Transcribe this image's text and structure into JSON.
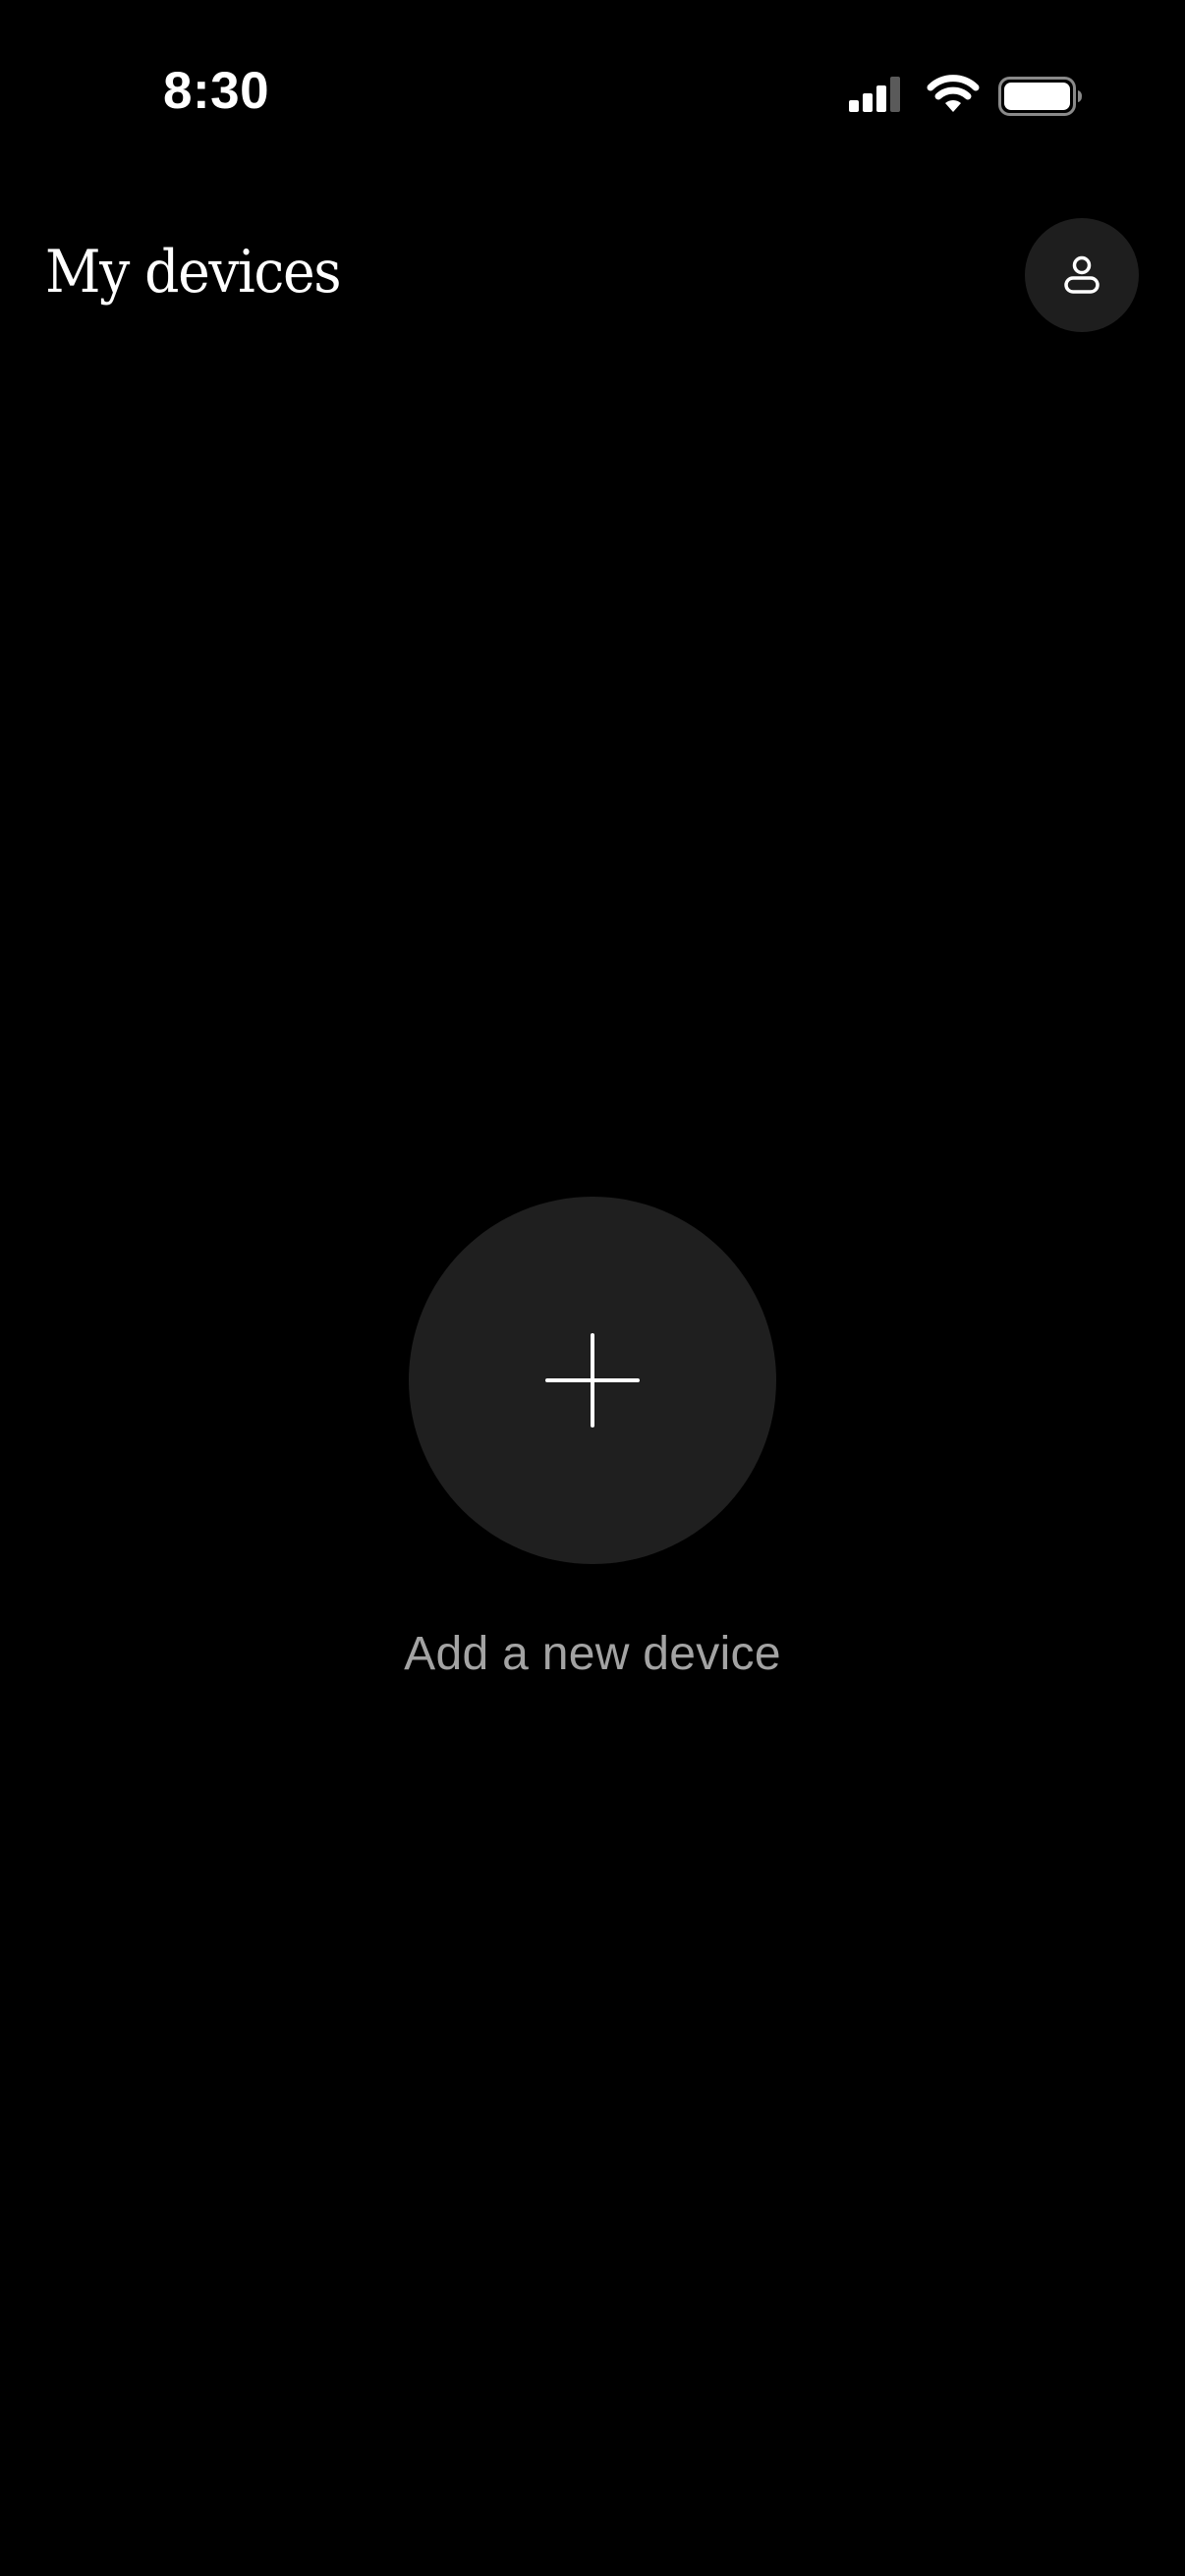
{
  "status_bar": {
    "time": "8:30",
    "signal_icon": "cellular-signal-icon",
    "wifi_icon": "wifi-icon",
    "battery_icon": "battery-icon"
  },
  "header": {
    "title": "My devices",
    "profile_icon": "person-icon"
  },
  "main": {
    "add_device_icon": "plus-icon",
    "add_device_label": "Add a new device"
  },
  "colors": {
    "background": "#000000",
    "surface": "#1f1f1f",
    "text_primary": "#ffffff",
    "text_secondary": "#a3a3a3"
  }
}
